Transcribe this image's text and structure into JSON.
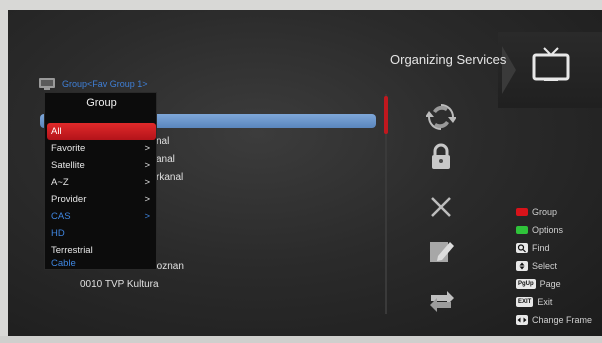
{
  "header": {
    "title": "Organizing Services",
    "group_caption": "Group<Fav Group 1>"
  },
  "channel_list": {
    "visible_fragments": [
      "nal",
      "anal",
      "rkanal",
      "Poznan",
      "0010   TVP Kultura"
    ]
  },
  "popup": {
    "title": "Group",
    "items": [
      {
        "label": "All",
        "arrow": "",
        "state": "selected"
      },
      {
        "label": "Favorite",
        "arrow": ">",
        "state": "normal"
      },
      {
        "label": "Satellite",
        "arrow": ">",
        "state": "normal"
      },
      {
        "label": "A~Z",
        "arrow": ">",
        "state": "normal"
      },
      {
        "label": "Provider",
        "arrow": ">",
        "state": "normal"
      },
      {
        "label": "CAS",
        "arrow": ">",
        "state": "blue"
      },
      {
        "label": "HD",
        "arrow": "",
        "state": "blue"
      },
      {
        "label": "Terrestrial",
        "arrow": "",
        "state": "normal"
      },
      {
        "label": "Cable",
        "arrow": "",
        "state": "blue"
      }
    ]
  },
  "actions": [
    "move-icon",
    "lock-icon",
    "delete-icon",
    "rename-icon",
    "skip-icon"
  ],
  "legend": {
    "group": "Group",
    "options": "Options",
    "find": "Find",
    "select": "Select",
    "page": "Page",
    "exit": "Exit",
    "change_frame": "Change Frame",
    "badge_page": "PgUp",
    "badge_exit": "EXIT"
  },
  "colors": {
    "accent_red": "#d8131a",
    "accent_green": "#2fc33a",
    "accent_blue": "#3f86e0"
  }
}
